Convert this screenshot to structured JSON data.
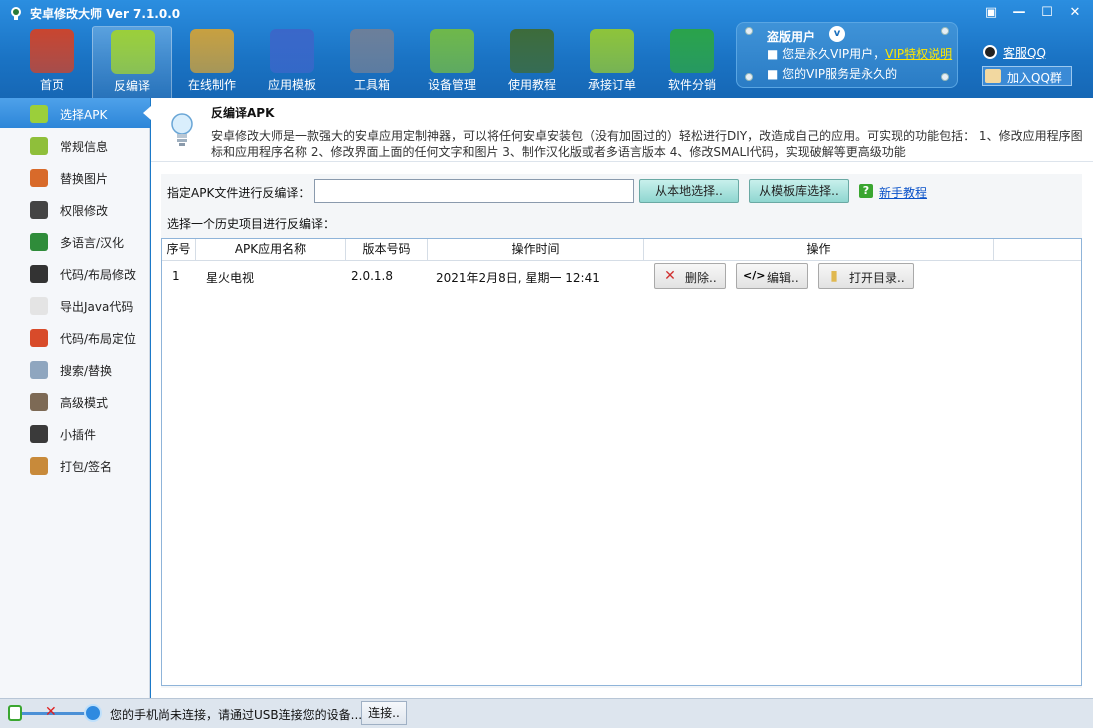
{
  "app": {
    "title": "安卓修改大师 Ver 7.1.0.0",
    "window_buttons": [
      "▣",
      "—",
      "☐",
      "✕"
    ]
  },
  "toolbar": {
    "items": [
      {
        "label": "首页",
        "icon": "house-icon",
        "color": "#c9452f"
      },
      {
        "label": "反编译",
        "icon": "android-icon",
        "color": "#9bcf3a"
      },
      {
        "label": "在线制作",
        "icon": "toolbox-icon",
        "color": "#c8a040"
      },
      {
        "label": "应用模板",
        "icon": "star-badge-icon",
        "color": "#3a67c9"
      },
      {
        "label": "工具箱",
        "icon": "safe-icon",
        "color": "#6c7f9a"
      },
      {
        "label": "设备管理",
        "icon": "radar-icon",
        "color": "#6fb84a"
      },
      {
        "label": "使用教程",
        "icon": "chalkboard-icon",
        "color": "#3d6b3a"
      },
      {
        "label": "承接订单",
        "icon": "shopping-bag-icon",
        "color": "#8ec43a"
      },
      {
        "label": "软件分销",
        "icon": "dollar-icon",
        "color": "#2aa34a"
      }
    ],
    "active_index": 1
  },
  "vip": {
    "title": "盗版用户",
    "line1_prefix": "■ 您是永久VIP用户，",
    "line1_link": "VIP特权说明",
    "line2": "■ 您的VIP服务是永久的"
  },
  "qq": {
    "service": "客服QQ",
    "group": "加入QQ群"
  },
  "sidebar": {
    "items": [
      {
        "label": "选择APK",
        "icon": "android-icon",
        "color": "#9bcf3a"
      },
      {
        "label": "常规信息",
        "icon": "android-info-icon",
        "color": "#8fbf3a"
      },
      {
        "label": "替换图片",
        "icon": "picture-icon",
        "color": "#d86a2a"
      },
      {
        "label": "权限修改",
        "icon": "lock-icon",
        "color": "#444"
      },
      {
        "label": "多语言/汉化",
        "icon": "globe-icon",
        "color": "#2f8c3a"
      },
      {
        "label": "代码/布局修改",
        "icon": "terminal-icon",
        "color": "#333"
      },
      {
        "label": "导出Java代码",
        "icon": "document-icon",
        "color": "#e4e4e4"
      },
      {
        "label": "代码/布局定位",
        "icon": "location-pin-icon",
        "color": "#d84b2a"
      },
      {
        "label": "搜索/替换",
        "icon": "magnifier-icon",
        "color": "#8fa6bf"
      },
      {
        "label": "高级模式",
        "icon": "tools-icon",
        "color": "#7d6a55"
      },
      {
        "label": "小插件",
        "icon": "android-plugin-icon",
        "color": "#3a3a3a"
      },
      {
        "label": "打包/签名",
        "icon": "package-icon",
        "color": "#c88a3a"
      }
    ],
    "active_index": 0
  },
  "info": {
    "title": "反编译APK",
    "text": "安卓修改大师是一款强大的安卓应用定制神器，可以将任何安卓安装包（没有加固过的）轻松进行DIY，改造成自己的应用。可实现的功能包括： 1、修改应用程序图标和应用程序名称 2、修改界面上面的任何文字和图片 3、制作汉化版或者多语言版本 4、修改SMALI代码，实现破解等更高级功能"
  },
  "apk": {
    "label": "指定APK文件进行反编译：",
    "input_value": "",
    "local_button": "从本地选择..",
    "template_button": "从模板库选择..",
    "help_link": "新手教程",
    "history_label": "选择一个历史项目进行反编译："
  },
  "table": {
    "headers": [
      "序号",
      "APK应用名称",
      "版本号码",
      "操作时间",
      "操作"
    ],
    "rows": [
      {
        "index": "1",
        "name": "星火电视",
        "version": "2.0.1.8",
        "time": "2021年2月8日, 星期一 12:41"
      }
    ],
    "actions": [
      {
        "label": "删除..",
        "icon": "delete-x-icon",
        "glyph": "✕",
        "color": "#d03030"
      },
      {
        "label": "编辑..",
        "icon": "code-icon",
        "glyph": "</>",
        "color": "#222"
      },
      {
        "label": "打开目录..",
        "icon": "folder-icon",
        "glyph": "▮",
        "color": "#e0b850"
      }
    ]
  },
  "status": {
    "text": "您的手机尚未连接，请通过USB连接您的设备...",
    "connect_button": "连接.."
  }
}
